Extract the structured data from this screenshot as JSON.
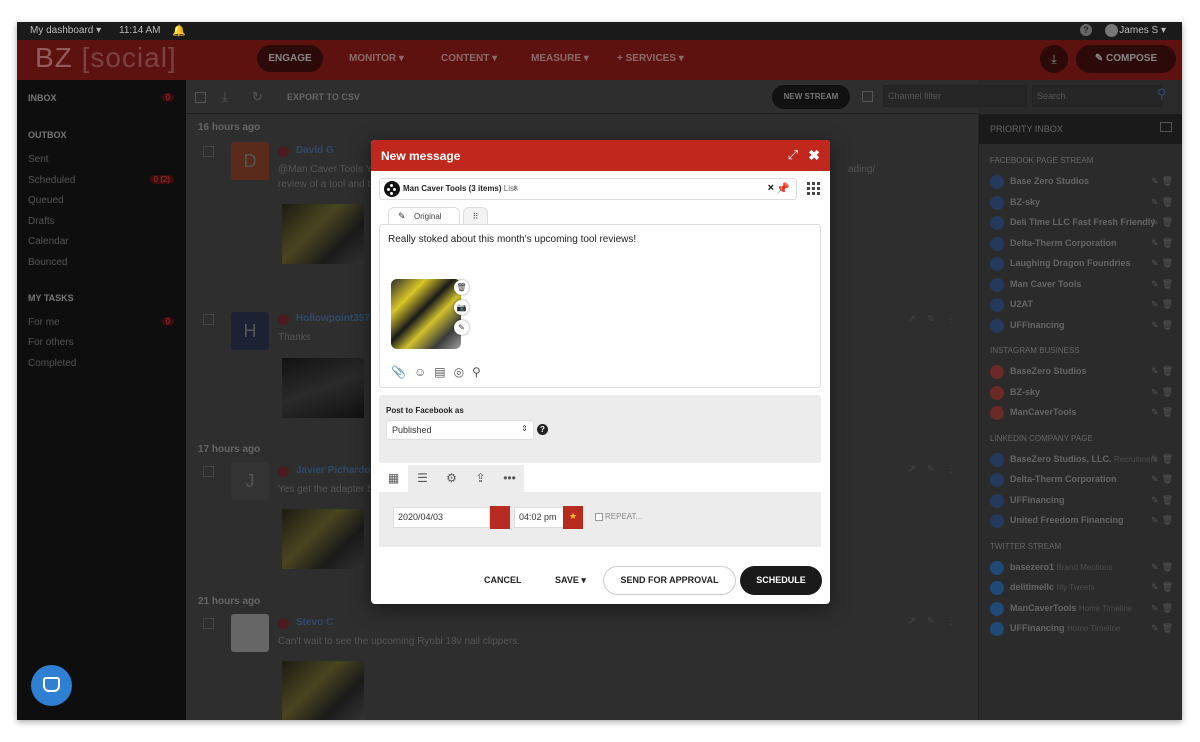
{
  "topbar": {
    "dashboard": "My dashboard ▾",
    "time": "11:14 AM",
    "user": "James S ▾",
    "help": "?"
  },
  "header": {
    "logo_a": "BZ",
    "logo_b": "[social]",
    "nav": [
      "ENGAGE",
      "MONITOR ▾",
      "CONTENT ▾",
      "MEASURE ▾",
      "+ SERVICES ▾"
    ],
    "compose": "COMPOSE"
  },
  "sidebar": {
    "inbox": "INBOX",
    "inbox_badge": "0",
    "outbox": "OUTBOX",
    "items": [
      "Sent",
      "Scheduled",
      "Queued",
      "Drafts",
      "Calendar",
      "Bounced"
    ],
    "scheduled_badge": "0 (2)",
    "tasks": "MY TASKS",
    "task_items": [
      "For me",
      "For others",
      "Completed"
    ],
    "for_me_badge": "0"
  },
  "feed": {
    "export": "EXPORT TO CSV",
    "new_stream": "NEW STREAM",
    "channel_placeholder": "Channel filter",
    "search_placeholder": "Search",
    "groups": [
      "16 hours ago",
      "17 hours ago",
      "21 hours ago"
    ],
    "posts": [
      {
        "initial": "D",
        "name": "David G",
        "text": "@Man Caver Tools Y",
        "text2": "review of a tool and t"
      },
      {
        "initial": "H",
        "name": "Hollowpoint357",
        "text": "Thanks"
      },
      {
        "initial": "J",
        "name": "Javier Pichardo",
        "text": "Yes get the adapter b"
      },
      {
        "initial": "",
        "name": "Stevo C",
        "text": "Can't wait to see the upcoming Ryobi 18v nail clippers."
      }
    ],
    "post1_tail": "ading/"
  },
  "priority": {
    "title": "PRIORITY INBOX",
    "sections": [
      {
        "title": "FACEBOOK PAGE STREAM",
        "items": [
          "Base Zero Studios",
          "BZ-sky",
          "Deli Time LLC Fast Fresh Friendly",
          "Delta-Therm Corporation",
          "Laughing Dragon Foundries",
          "Man Caver Tools",
          "U2AT",
          "UFFinancing"
        ]
      },
      {
        "title": "INSTAGRAM BUSINESS",
        "items": [
          "BaseZero Studios",
          "BZ-sky",
          "ManCaverTools"
        ]
      },
      {
        "title": "LINKEDIN COMPANY PAGE",
        "items": [
          "BaseZero Studios, LLC.",
          "Delta-Therm Corporation",
          "UFFinancing",
          "United Freedom Financing"
        ],
        "sub0": "Recruitment"
      },
      {
        "title": "TWITTER STREAM",
        "items": [
          "basezero1",
          "delitimellc",
          "ManCaverTools",
          "UFFinancing"
        ],
        "subs": [
          "Brand Mentions",
          "My Tweets",
          "Home Timeline",
          "Home Timeline"
        ]
      }
    ]
  },
  "modal": {
    "title": "New message",
    "recipient": "Man Caver Tools (3 items)",
    "recipient_type": "List",
    "tab_original": "Original",
    "message": "Really stoked about this month's upcoming tool reviews!",
    "post_as_label": "Post to Facebook as",
    "post_as_value": "Published",
    "date": "2020/04/03",
    "time": "04:02 pm",
    "repeat": "REPEAT...",
    "cancel": "CANCEL",
    "save": "SAVE ▾",
    "send_approval": "SEND FOR APPROVAL",
    "schedule": "SCHEDULE"
  }
}
